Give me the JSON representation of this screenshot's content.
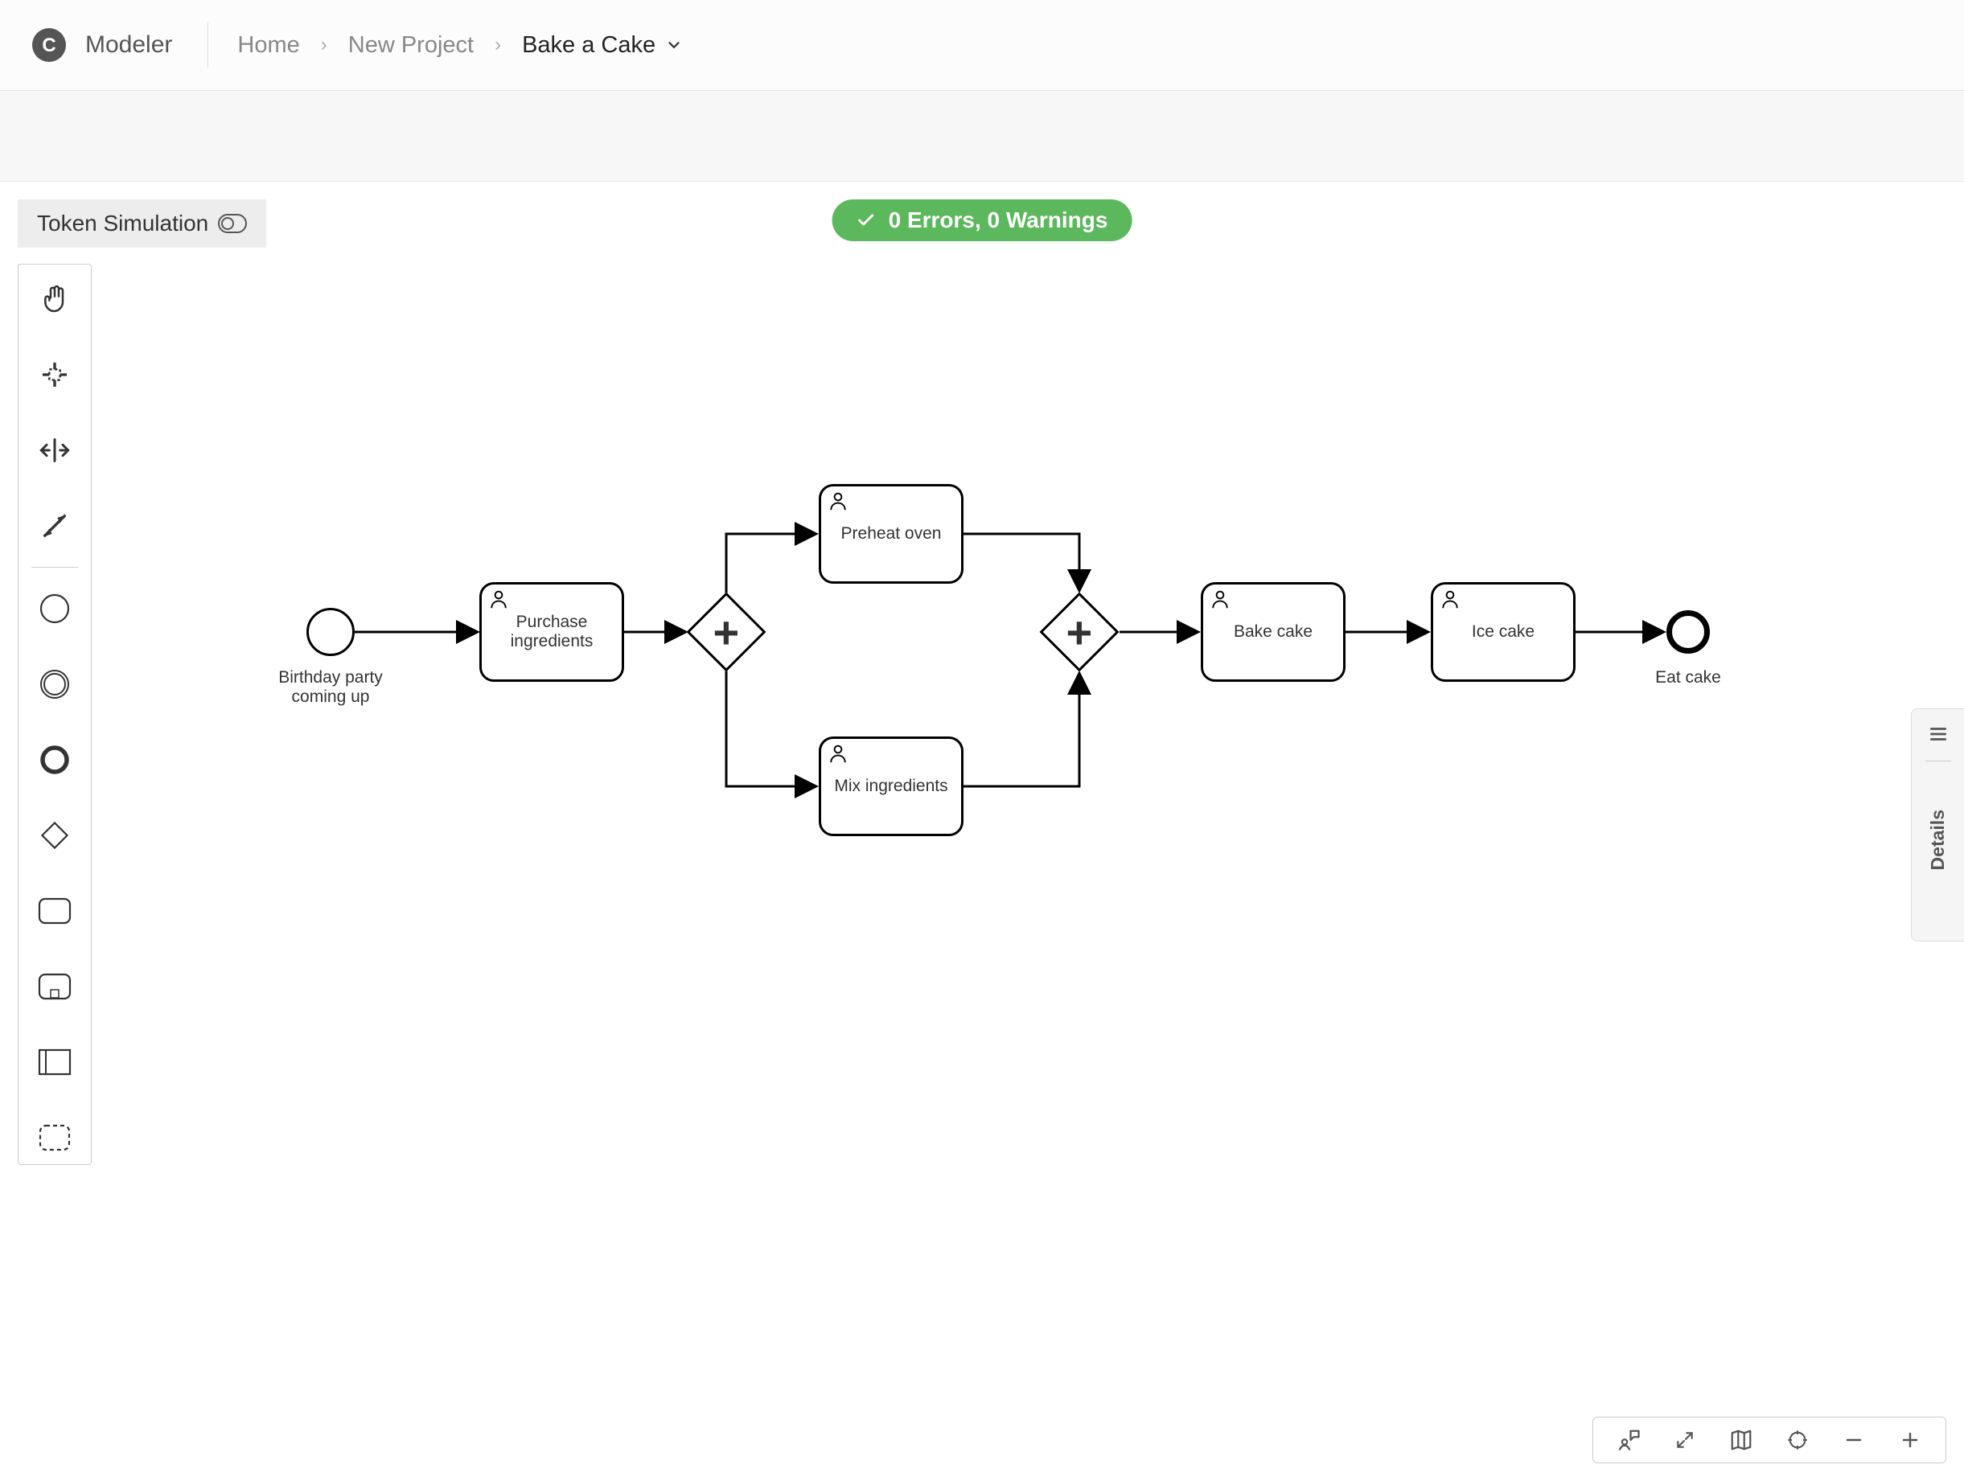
{
  "header": {
    "app_name": "Modeler",
    "breadcrumb": {
      "home": "Home",
      "project": "New Project",
      "current": "Bake a Cake"
    }
  },
  "token_sim_label": "Token Simulation",
  "validation_text": "0 Errors, 0 Warnings",
  "details_label": "Details",
  "diagram": {
    "start_event_label": "Birthday party coming up",
    "end_event_label": "Eat cake",
    "tasks": {
      "purchase": "Purchase ingredients",
      "preheat": "Preheat oven",
      "mix": "Mix ingredients",
      "bake": "Bake cake",
      "ice": "Ice cake"
    }
  }
}
